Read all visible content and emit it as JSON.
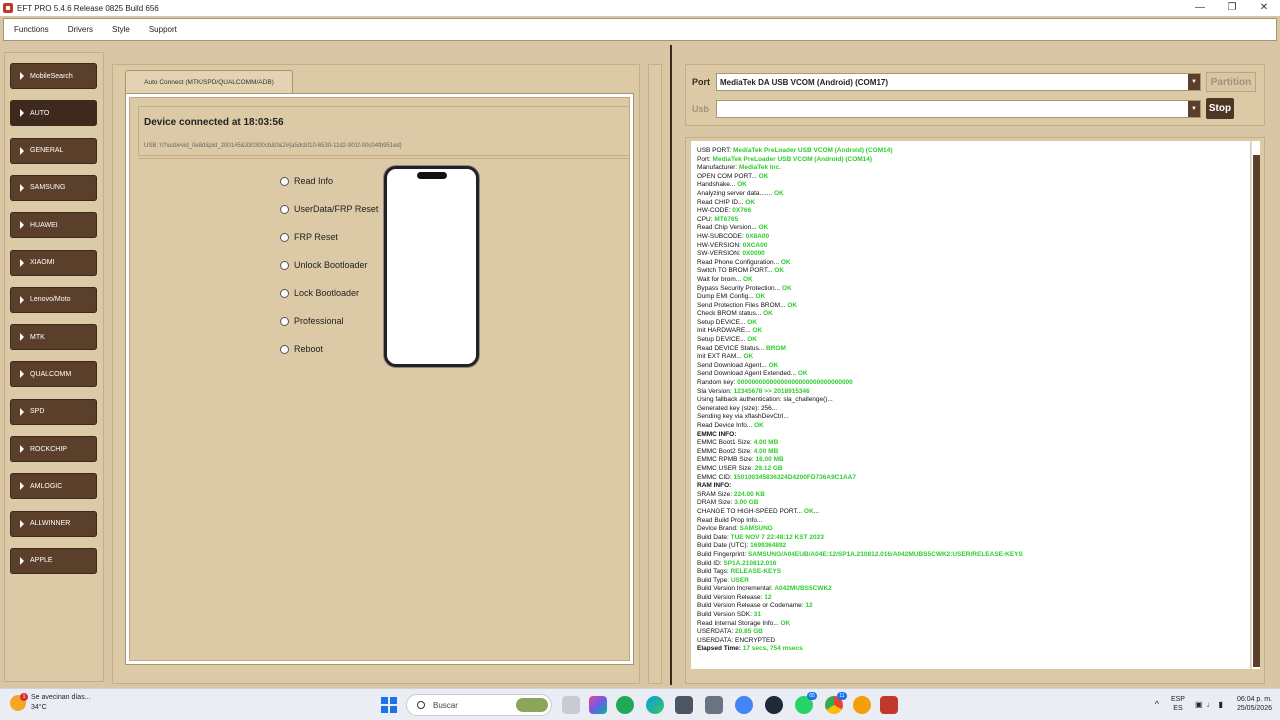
{
  "window": {
    "title": "EFT PRO 5.4.6 Release 0825 Build 656"
  },
  "menu": [
    "Functions",
    "Drivers",
    "Style",
    "Support"
  ],
  "sidebar": {
    "items": [
      {
        "label": "MobileSearch"
      },
      {
        "label": "AUTO"
      },
      {
        "label": "GENERAL"
      },
      {
        "label": "SAMSUNG"
      },
      {
        "label": "HUAWEI"
      },
      {
        "label": "XIAOMI"
      },
      {
        "label": "Lenovo/Moto"
      },
      {
        "label": "MTK"
      },
      {
        "label": "QUALCOMM"
      },
      {
        "label": "SPD"
      },
      {
        "label": "ROCKCHIP"
      },
      {
        "label": "AMLOGIC"
      },
      {
        "label": "ALLWINNER"
      },
      {
        "label": "APPLE"
      }
    ],
    "active": "AUTO"
  },
  "tab": {
    "label": "Auto Connect (MTK/SPD/QUALCOMM/ADB)"
  },
  "device": {
    "status": "Device connected at 18:03:56",
    "usb_path": "USB: \\\\?\\usb#vid_0e8d&pid_2001#5&330300cb&0&2#{a5dcbf10-6530-11d2-901f-00c04fb951ed}"
  },
  "operations": [
    "Read Info",
    "UserData/FRP Reset",
    "FRP Reset",
    "Unlock Bootloader",
    "Lock Bootloader",
    "Professional",
    "Reboot"
  ],
  "port": {
    "port_label": "Port",
    "port_value": "MediaTek DA USB VCOM (Android) (COM17)",
    "usb_label": "Usb",
    "usb_value": "",
    "partition_label": "Partition",
    "stop_label": "Stop"
  },
  "log": [
    {
      "text": "USB PORT: ",
      "value": "MediaTek PreLoader USB VCOM (Android) (COM14)"
    },
    {
      "text": "Port: ",
      "value": "MediaTek PreLoader USB VCOM (Android) (COM14)"
    },
    {
      "text": "Manufacturer: ",
      "value": "MediaTek Inc."
    },
    {
      "text": "OPEN COM PORT... ",
      "value": "OK"
    },
    {
      "text": "Handshake... ",
      "value": "OK"
    },
    {
      "text": "Analyzing server data....... ",
      "value": "OK"
    },
    {
      "text": "Read CHIP ID... ",
      "value": "OK"
    },
    {
      "text": "HW-CODE: ",
      "value": "0X766"
    },
    {
      "text": "CPU: ",
      "value": "MT6765"
    },
    {
      "text": "Read Chip Version... ",
      "value": "OK"
    },
    {
      "text": "HW-SUBCODE: ",
      "value": "0X8A00"
    },
    {
      "text": "HW-VERSION: ",
      "value": "0XCA00"
    },
    {
      "text": "SW-VERSION: ",
      "value": "0X0000"
    },
    {
      "text": "Read Phone Configuration... ",
      "value": "OK"
    },
    {
      "text": "Switch TO BROM PORT... ",
      "value": "OK"
    },
    {
      "text": "Wait for brom... ",
      "value": "OK"
    },
    {
      "text": "Bypass Security Protection... ",
      "value": "OK"
    },
    {
      "text": "Dump EMI Config... ",
      "value": "OK"
    },
    {
      "text": "Send Protection Files BROM... ",
      "value": "OK"
    },
    {
      "text": "Check BROM status... ",
      "value": "OK"
    },
    {
      "text": "Setup DEVICE... ",
      "value": "OK"
    },
    {
      "text": "Init HARDWARE... ",
      "value": "OK"
    },
    {
      "text": "Setup DEVICE... ",
      "value": "OK"
    },
    {
      "text": "Read DEVICE Status... ",
      "value": "BROM"
    },
    {
      "text": "Init EXT RAM... ",
      "value": "OK"
    },
    {
      "text": "Send Download Agent... ",
      "value": "OK"
    },
    {
      "text": "Send Download Agent Extended... ",
      "value": "OK"
    },
    {
      "text": "Random key:  ",
      "value": "00000000000000000000000000000000"
    },
    {
      "text": "Sla Version:  ",
      "value": "12345678  >> 2018915346"
    },
    {
      "text": "Using fallback authentication: sla_challenge()...",
      "value": ""
    },
    {
      "text": "Generated key (size): 256...",
      "value": ""
    },
    {
      "text": "Sending key via xflashDevCtrl...",
      "value": ""
    },
    {
      "text": "Read Device Info... ",
      "value": "OK"
    },
    {
      "text": "EMMC INFO:",
      "value": "",
      "hdr": true
    },
    {
      "text": "EMMC Boot1 Size: ",
      "value": "4.00 MB"
    },
    {
      "text": "EMMC Boot2 Size: ",
      "value": "4.00 MB"
    },
    {
      "text": "EMMC RPMB Size: ",
      "value": "16.00 MB"
    },
    {
      "text": "EMMC USER Size: ",
      "value": "29.12 GB"
    },
    {
      "text": "EMMC CID: ",
      "value": "150100345836324D4200FD736A9C1AA7"
    },
    {
      "text": "RAM INFO:",
      "value": "",
      "hdr": true
    },
    {
      "text": "SRAM Size: ",
      "value": "224.00 KB"
    },
    {
      "text": "DRAM Size: ",
      "value": "3.00 GB"
    },
    {
      "text": "CHANGE TO HIGH-SPEED PORT... ",
      "value": "OK..."
    },
    {
      "text": "Read Build Prop Info...",
      "value": ""
    },
    {
      "text": " Device Brand: ",
      "value": "SAMSUNG"
    },
    {
      "text": " Build Date: ",
      "value": "TUE NOV  7 22:48:12 KST 2023"
    },
    {
      "text": " Build Date (UTC): ",
      "value": "1699364892"
    },
    {
      "text": " Build Fingerprint: ",
      "value": "SAMSUNG/A04EUB/A04E:12/SP1A.210812.016/A042MUBS5CWK2:USER/RELEASE-KEYS"
    },
    {
      "text": " Build ID: ",
      "value": "SP1A.210812.016"
    },
    {
      "text": " Build Tags: ",
      "value": "RELEASE-KEYS"
    },
    {
      "text": " Build Type: ",
      "value": "USER"
    },
    {
      "text": " Build Version Incremental: ",
      "value": "A042MUBS5CWK2"
    },
    {
      "text": " Build Version Release: ",
      "value": "12"
    },
    {
      "text": " Build Version Release or Codename: ",
      "value": "12"
    },
    {
      "text": " Build Version SDK: ",
      "value": "31"
    },
    {
      "text": "Read Internal Storage Info... ",
      "value": "OK"
    },
    {
      "text": "USERDATA: ",
      "value": "20.85 GB"
    },
    {
      "text": "USERDATA: ENCRYPTED",
      "value": ""
    },
    {
      "text": "Elapsed Time: ",
      "value": "17 secs, 754 msecs",
      "hdr": true
    }
  ],
  "taskbar": {
    "weather_text": "Se avecinan días...",
    "weather_temp": "34°C",
    "weather_badge": "1",
    "search_label": "Buscar",
    "whatsapp_count": "65",
    "chrome_count": "11",
    "lang_top": "ESP",
    "lang_bottom": "ES",
    "time": "06:04 p. m.",
    "date": "25/05/2026"
  },
  "colors": {
    "accent": "#5a3f2b",
    "background": "#d9c6a4",
    "log_value": "#2ecc2e"
  }
}
